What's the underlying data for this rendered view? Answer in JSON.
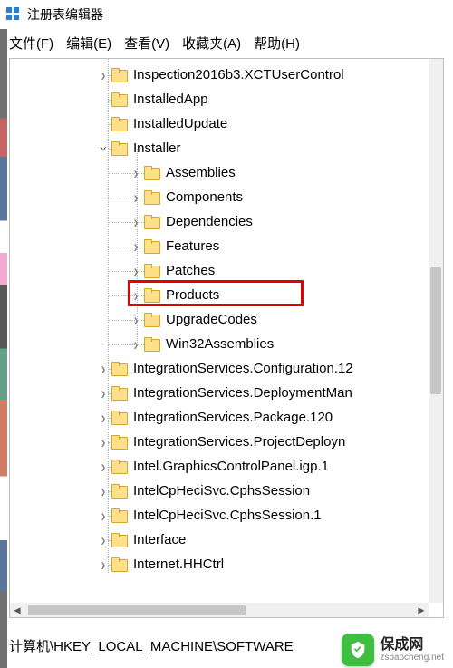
{
  "title": "注册表编辑器",
  "menu": {
    "file": "文件(F)",
    "edit": "编辑(E)",
    "view": "查看(V)",
    "favorites": "收藏夹(A)",
    "help": "帮助(H)"
  },
  "tree": {
    "baseIndent": 132,
    "childIndent": 168,
    "nodes": [
      {
        "label": "Inspection2016b3.XCTUserControl",
        "level": 0,
        "exp": "collapsed"
      },
      {
        "label": "InstalledApp",
        "level": 0,
        "exp": "none"
      },
      {
        "label": "InstalledUpdate",
        "level": 0,
        "exp": "none"
      },
      {
        "label": "Installer",
        "level": 0,
        "exp": "expanded"
      },
      {
        "label": "Assemblies",
        "level": 1,
        "exp": "collapsed"
      },
      {
        "label": "Components",
        "level": 1,
        "exp": "collapsed"
      },
      {
        "label": "Dependencies",
        "level": 1,
        "exp": "collapsed"
      },
      {
        "label": "Features",
        "level": 1,
        "exp": "collapsed"
      },
      {
        "label": "Patches",
        "level": 1,
        "exp": "collapsed"
      },
      {
        "label": "Products",
        "level": 1,
        "exp": "collapsed",
        "highlight": true
      },
      {
        "label": "UpgradeCodes",
        "level": 1,
        "exp": "collapsed"
      },
      {
        "label": "Win32Assemblies",
        "level": 1,
        "exp": "collapsed"
      },
      {
        "label": "IntegrationServices.Configuration.12",
        "level": 0,
        "exp": "collapsed"
      },
      {
        "label": "IntegrationServices.DeploymentMan",
        "level": 0,
        "exp": "collapsed"
      },
      {
        "label": "IntegrationServices.Package.120",
        "level": 0,
        "exp": "collapsed"
      },
      {
        "label": "IntegrationServices.ProjectDeployn",
        "level": 0,
        "exp": "collapsed"
      },
      {
        "label": "Intel.GraphicsControlPanel.igp.1",
        "level": 0,
        "exp": "collapsed"
      },
      {
        "label": "IntelCpHeciSvc.CphsSession",
        "level": 0,
        "exp": "collapsed"
      },
      {
        "label": "IntelCpHeciSvc.CphsSession.1",
        "level": 0,
        "exp": "collapsed"
      },
      {
        "label": "Interface",
        "level": 0,
        "exp": "collapsed"
      },
      {
        "label": "Internet.HHCtrl",
        "level": 0,
        "exp": "collapsed"
      }
    ]
  },
  "statusbar": "计算机\\HKEY_LOCAL_MACHINE\\SOFTWARE",
  "watermark": {
    "cn": "保成网",
    "en": "zsbaocheng.net"
  }
}
